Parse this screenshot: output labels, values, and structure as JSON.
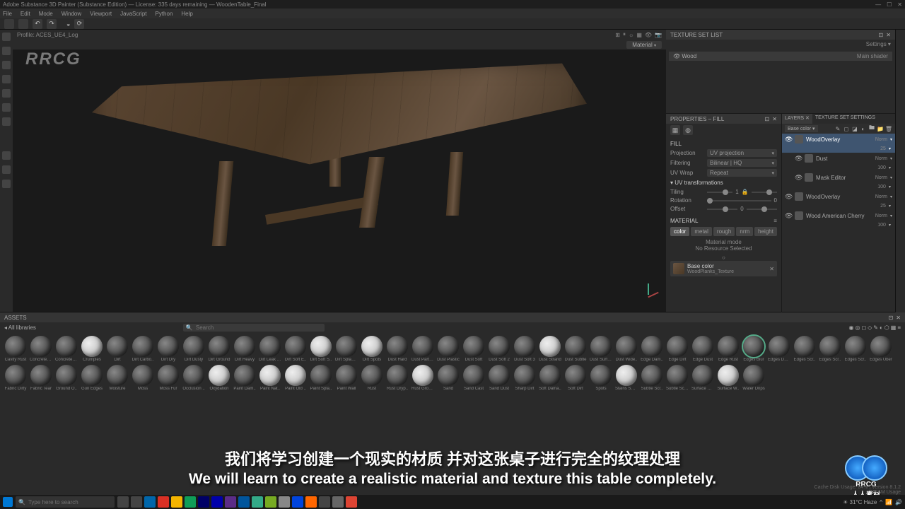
{
  "title_bar": {
    "text": "Adobe Substance 3D Painter (Substance Edition) — License: 335 days remaining — WoodenTable_Final"
  },
  "menu": [
    "File",
    "Edit",
    "Mode",
    "Window",
    "Viewport",
    "JavaScript",
    "Python",
    "Help"
  ],
  "viewport": {
    "profile": "Profile: ACES_UE4_Log",
    "material_dropdown": "Material"
  },
  "texture_set_list": {
    "title": "TEXTURE SET LIST",
    "settings": "Settings",
    "items": [
      {
        "name": "Wood",
        "shader": "Main shader"
      }
    ]
  },
  "properties": {
    "title": "PROPERTIES – FILL",
    "fill_section": "FILL",
    "projection_label": "Projection",
    "projection_value": "UV projection",
    "filtering_label": "Filtering",
    "filtering_value": "Bilinear | HQ",
    "uvwrap_label": "UV Wrap",
    "uvwrap_value": "Repeat",
    "uv_transform": "UV transformations",
    "tiling_label": "Tiling",
    "tiling_val": "1",
    "rotation_label": "Rotation",
    "rotation_val": "0",
    "offset_label": "Offset",
    "offset_val": "0",
    "material_section": "MATERIAL",
    "toggles": [
      "color",
      "metal",
      "rough",
      "nrm",
      "height"
    ],
    "material_mode": "Material mode",
    "no_resource": "No Resource Selected",
    "base_color_label": "Base color",
    "base_color_resource": "WoodPlanks_Texture"
  },
  "layers": {
    "tabs": [
      "LAYERS",
      "TEXTURE SET SETTINGS"
    ],
    "channel_dropdown": "Base color",
    "items": [
      {
        "name": "WoodOverlay",
        "blend": "Norm",
        "opacity": "25",
        "selected": true
      },
      {
        "name": "Dust",
        "blend": "Norm",
        "opacity": "100",
        "sub": true
      },
      {
        "name": "Mask Editor",
        "blend": "Norm",
        "opacity": "100",
        "sub": true,
        "subsub": true
      },
      {
        "name": "WoodOverlay",
        "blend": "Norm",
        "opacity": "25"
      },
      {
        "name": "Wood American Cherry",
        "blend": "Norm",
        "opacity": "100"
      }
    ]
  },
  "assets": {
    "title": "ASSETS",
    "filter": "All libraries",
    "search_placeholder": "Search",
    "items": [
      "Cavity Rust",
      "Concrete E..",
      "Concrete S..",
      "Crumples",
      "Dirt",
      "Dirt Carbo..",
      "Dirt Dry",
      "Dirt Dusty",
      "Dirt Ground",
      "Dirt Heavy",
      "Dirt Leak Dry",
      "Dirt Soft E..",
      "Dirt Soft S..",
      "Dirt Splashes",
      "Dirt Spots",
      "Dust Hard",
      "Dust Partic..",
      "Dust Plastic",
      "Dust Soft",
      "Dust Soft 2",
      "Dust Soft 3",
      "Dust Strand",
      "Dust Subtle",
      "Dust Surface",
      "Dust Wide..",
      "Edge Dam..",
      "Edge Dirt",
      "Edge Dust",
      "Edge Rust",
      "Edges Blur",
      "Edges Dusty",
      "Edges Scr..",
      "Edges Scr..",
      "Edges Scr..",
      "Edges Uber",
      "Fabric Dirty",
      "Fabric Tear",
      "Ground O..",
      "Gun Edges",
      "Moisture",
      "Moss",
      "Moss Fur",
      "Occlusion ..",
      "Oxydation",
      "Paint Dam..",
      "Paint Nat..",
      "Paint Old ..",
      "Paint Spla..",
      "Paint Wall",
      "Rust",
      "Rust Dryp..",
      "Rust Ground",
      "Sand",
      "Sand Cast",
      "Sand Dust",
      "Sharp Dirt",
      "Soft Dama..",
      "Soft Dirt",
      "Spots",
      "Stains Smo..",
      "Subtle Scr..",
      "Subtle Sca..",
      "Surface Rust",
      "Surface W..",
      "Water Drips"
    ]
  },
  "subtitle": {
    "cn": "我们将学习创建一个现实的材质 并对这张桌子进行完全的纹理处理",
    "en": "We will learn to create a realistic material and texture this table completely."
  },
  "watermark": "RRCG",
  "watermark_cn": "人人素材",
  "taskbar": {
    "search_placeholder": "Type here to search",
    "weather": "31°C Haze",
    "app_colors": [
      "#444",
      "#444",
      "#06a",
      "#d93025",
      "#f4b400",
      "#0f9d58",
      "#006",
      "#00a",
      "#5b2c87",
      "#00559c",
      "#3a8",
      "#7a2",
      "#888",
      "#04d",
      "#f60",
      "#444",
      "#666",
      "#d43"
    ]
  },
  "statusbar": {
    "disk": "Cache Disk Usage: 84% | Version 8.1.2",
    "vram": "VRAM Usage"
  }
}
